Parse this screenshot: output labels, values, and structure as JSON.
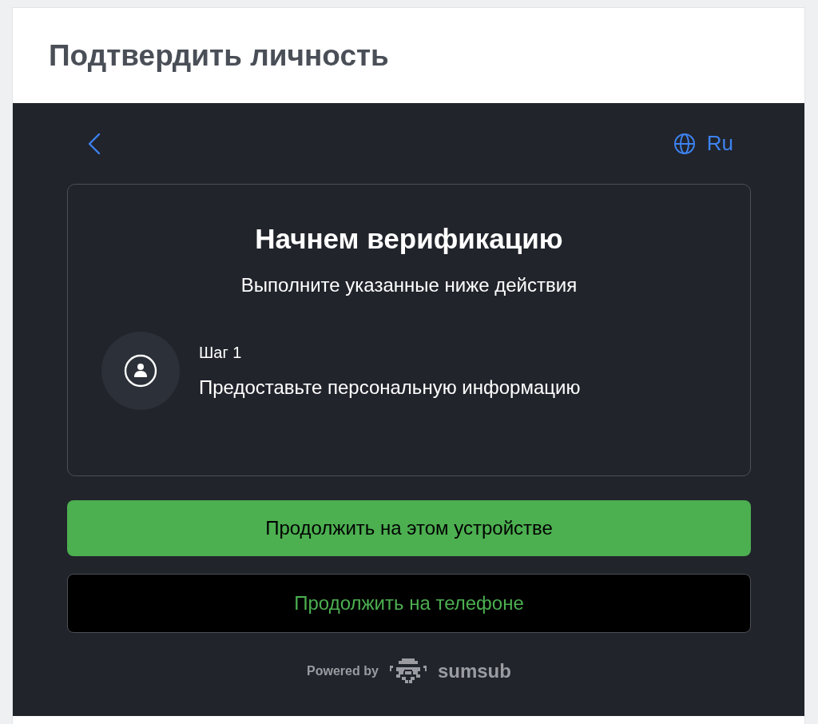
{
  "header": {
    "title": "Подтвердить личность"
  },
  "nav": {
    "language": "Ru"
  },
  "card": {
    "title": "Начнем верификацию",
    "subtitle": "Выполните указанные ниже действия",
    "steps": [
      {
        "label": "Шаг 1",
        "text": "Предоставьте персональную информацию"
      }
    ]
  },
  "buttons": [
    {
      "kind": "primary",
      "label": "Продолжить на этом устройстве"
    },
    {
      "kind": "secondary",
      "label": "Продолжить на телефоне"
    }
  ],
  "footer": {
    "powered_by": "Powered by",
    "brand": "sumsub"
  }
}
